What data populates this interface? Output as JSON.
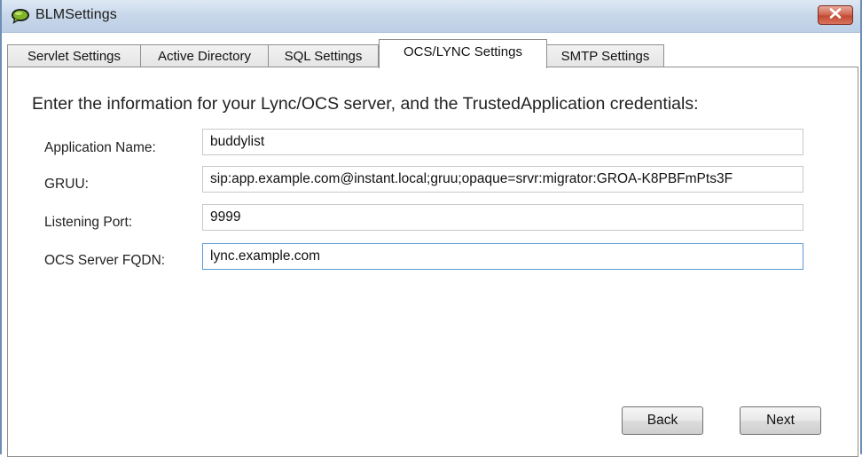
{
  "window": {
    "title": "BLMSettings",
    "app_icon": "speech-bubble-icon",
    "close_icon": "close-icon",
    "colors": {
      "titlebar": "#c9d8ea",
      "close_button": "#c24a33",
      "icon_bubble": "#7fb526",
      "focus_border": "#5b9bd5"
    }
  },
  "tabs": [
    {
      "label": "Servlet Settings",
      "active": false
    },
    {
      "label": "Active Directory",
      "active": false
    },
    {
      "label": "SQL Settings",
      "active": false
    },
    {
      "label": "OCS/LYNC Settings",
      "active": true
    },
    {
      "label": "SMTP Settings",
      "active": false
    }
  ],
  "panel": {
    "intro": "Enter the information for your Lync/OCS server, and the TrustedApplication credentials:",
    "fields": [
      {
        "label": "Application Name:",
        "value": "buddylist"
      },
      {
        "label": "GRUU:",
        "value": "sip:app.example.com@instant.local;gruu;opaque=srvr:migrator:GROA-K8PBFmPts3F"
      },
      {
        "label": "Listening Port:",
        "value": "9999"
      },
      {
        "label": "OCS Server FQDN:",
        "value": "lync.example.com"
      }
    ]
  },
  "buttons": {
    "back": "Back",
    "next": "Next"
  }
}
